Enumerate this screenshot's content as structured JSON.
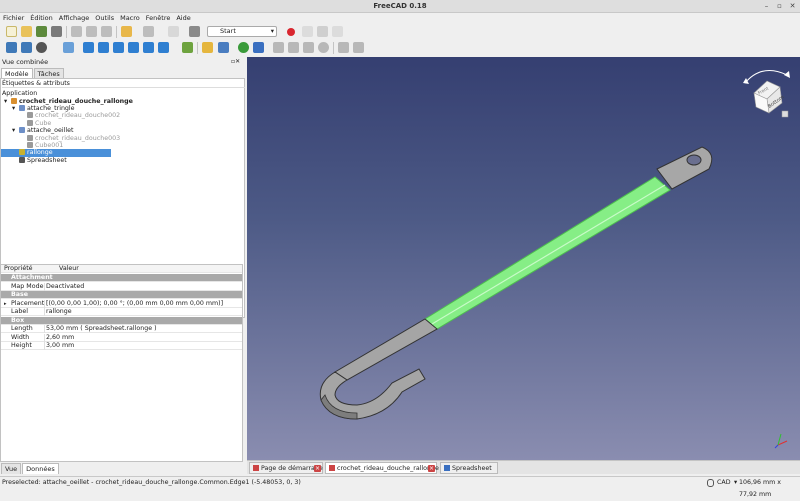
{
  "window": {
    "title": "FreeCAD 0.18",
    "controls": [
      "–",
      "▫",
      "✕"
    ]
  },
  "menu": [
    "Fichier",
    "Édition",
    "Affichage",
    "Outils",
    "Macro",
    "Fenêtre",
    "Aide"
  ],
  "toolbar": {
    "workbench": "Start"
  },
  "combo_view": {
    "title": "Vue combinée",
    "tabs": [
      "Modèle",
      "Tâches"
    ],
    "labels_header": "Étiquettes & attributs",
    "application_label": "Application",
    "tree": [
      {
        "label": "crochet_rideau_douche_rallonge",
        "level": 0,
        "bold": true,
        "greyed": false
      },
      {
        "label": "attache_tringle",
        "level": 1,
        "bold": false,
        "greyed": false
      },
      {
        "label": "crochet_rideau_douche002",
        "level": 2,
        "bold": false,
        "greyed": true
      },
      {
        "label": "Cube",
        "level": 2,
        "bold": false,
        "greyed": true
      },
      {
        "label": "attache_oeillet",
        "level": 1,
        "bold": false,
        "greyed": false
      },
      {
        "label": "crochet_rideau_douche003",
        "level": 2,
        "bold": false,
        "greyed": true
      },
      {
        "label": "Cube001",
        "level": 2,
        "bold": false,
        "greyed": true
      },
      {
        "label": "rallonge",
        "level": 1,
        "bold": false,
        "greyed": false,
        "selected": true
      },
      {
        "label": "Spreadsheet",
        "level": 1,
        "bold": false,
        "greyed": false
      }
    ],
    "property_headers": {
      "name": "Propriété",
      "value": "Valeur"
    },
    "properties": {
      "group_attachment": "Attachment",
      "map_mode_name": "Map Mode",
      "map_mode_value": "Deactivated",
      "group_base": "Base",
      "placement_name": "Placement",
      "placement_value": "[(0,00 0,00 1,00); 0,00 °; (0,00 mm  0,00 mm  0,00 mm)]",
      "label_name": "Label",
      "label_value": "rallonge",
      "group_box": "Box",
      "length_name": "Length",
      "length_value": "53,00 mm  ( Spreadsheet.rallonge )",
      "width_name": "Width",
      "width_value": "2,60 mm",
      "height_name": "Height",
      "height_value": "3,00 mm"
    },
    "bottom_tabs": [
      "Vue",
      "Données"
    ]
  },
  "navcube": {
    "face_top": "Front",
    "face_right": "Bottom"
  },
  "doc_tabs": [
    "Page de démarrage",
    "crochet_rideau_douche_rallonge : 1",
    "Spreadsheet"
  ],
  "status": {
    "message": "Preselected: attache_oeillet - crochet_rideau_douche_rallonge.Common.Edge1 (-5.48053, 0, 3)",
    "nav_style": "CAD",
    "dimensions": "106,96 mm x 77,92 mm"
  },
  "colors": {
    "selection": "#4a90d9",
    "highlight_green": "#8df08d",
    "view_top": "#353f71",
    "view_bottom": "#8a8db0"
  }
}
